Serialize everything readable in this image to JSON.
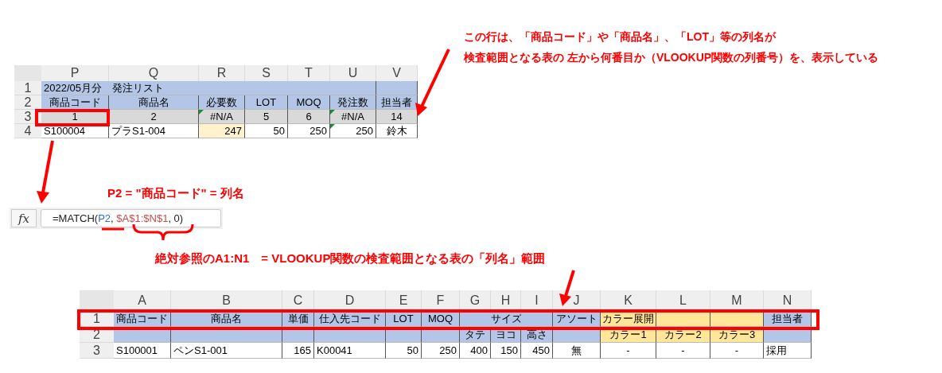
{
  "annotations": [
    {
      "kind": "title",
      "lines": [
        "この行は、「商品コード」や「商品名」、「LOT」等の列名が",
        "検査範囲となる表の 左から何番目か（VLOOKUP関数の列番号）を、表示している"
      ]
    },
    {
      "kind": "formula",
      "lines": [
        "P2 = \"商品コード\" = 列名"
      ]
    },
    {
      "kind": "range",
      "lines": [
        "絶対参照のA1:N1　= VLOOKUP関数の検査範囲となる表の「列名」範囲"
      ]
    }
  ],
  "sheets": [
    {
      "columns": [
        "P",
        "Q",
        "R",
        "S",
        "T",
        "U",
        "V"
      ],
      "rows": [
        {
          "number": "1",
          "cells": [
            {
              "text": "2022/05月分　発注リスト",
              "kind": "title"
            },
            {
              "kind": "merged"
            },
            {
              "kind": "merged"
            },
            {
              "kind": "merged"
            },
            {
              "kind": "merged"
            },
            {
              "kind": "merged"
            },
            {
              "kind": "header"
            }
          ]
        },
        {
          "number": "2",
          "cells": [
            {
              "text": "商品コード",
              "kind": "header"
            },
            {
              "text": "商品名",
              "kind": "header"
            },
            {
              "text": "必要数",
              "kind": "header"
            },
            {
              "text": "LOT",
              "kind": "header"
            },
            {
              "text": "MOQ",
              "kind": "header"
            },
            {
              "text": "発注数",
              "kind": "header"
            },
            {
              "text": "担当者",
              "kind": "header"
            }
          ]
        },
        {
          "number": "3",
          "cells": [
            {
              "text": "1",
              "kind": "index"
            },
            {
              "text": "2",
              "kind": "index"
            },
            {
              "text": "#N/A",
              "kind": "index",
              "flag": true
            },
            {
              "text": "5",
              "kind": "index"
            },
            {
              "text": "6",
              "kind": "index"
            },
            {
              "text": "#N/A",
              "kind": "index",
              "flag": true
            },
            {
              "text": "14",
              "kind": "index"
            }
          ]
        },
        {
          "number": "4",
          "cells": [
            {
              "text": "S100004",
              "kind": "text"
            },
            {
              "text": "プラS1-004",
              "kind": "text"
            },
            {
              "text": "247",
              "kind": "input"
            },
            {
              "text": "50",
              "kind": "number"
            },
            {
              "text": "250",
              "kind": "number"
            },
            {
              "text": "250",
              "kind": "number",
              "flag": true
            },
            {
              "text": "鈴木",
              "kind": "center"
            }
          ]
        }
      ]
    },
    {
      "columns": [
        "A",
        "B",
        "C",
        "D",
        "E",
        "F",
        "G",
        "H",
        "I",
        "J",
        "K",
        "L",
        "M",
        "N"
      ],
      "rows": [
        {
          "number": "1",
          "cells": [
            {
              "text": "商品コード",
              "kind": "header"
            },
            {
              "text": "商品名",
              "kind": "header"
            },
            {
              "text": "単価",
              "kind": "header"
            },
            {
              "text": "仕入先コード",
              "kind": "header"
            },
            {
              "text": "LOT",
              "kind": "header"
            },
            {
              "text": "MOQ",
              "kind": "header"
            },
            {
              "kind": "header-open"
            },
            {
              "text": "サイズ",
              "kind": "header-open"
            },
            {
              "kind": "header"
            },
            {
              "text": "アソート",
              "kind": "header"
            },
            {
              "text": "カラー展開",
              "kind": "accent"
            },
            {
              "kind": "accent"
            },
            {
              "kind": "accent"
            },
            {
              "text": "担当者",
              "kind": "header"
            }
          ]
        },
        {
          "number": "2",
          "cells": [
            {
              "kind": "header"
            },
            {
              "kind": "header"
            },
            {
              "kind": "header"
            },
            {
              "kind": "header"
            },
            {
              "kind": "header"
            },
            {
              "kind": "header"
            },
            {
              "text": "タテ",
              "kind": "header"
            },
            {
              "text": "ヨコ",
              "kind": "header"
            },
            {
              "text": "高さ",
              "kind": "header"
            },
            {
              "kind": "header"
            },
            {
              "text": "カラー1",
              "kind": "accent"
            },
            {
              "text": "カラー2",
              "kind": "accent"
            },
            {
              "text": "カラー3",
              "kind": "accent"
            },
            {
              "kind": "header"
            }
          ]
        },
        {
          "number": "3",
          "cells": [
            {
              "text": "S100001",
              "kind": "text"
            },
            {
              "text": "ペンS1-001",
              "kind": "text"
            },
            {
              "text": "165",
              "kind": "number"
            },
            {
              "text": "K00041",
              "kind": "text"
            },
            {
              "text": "50",
              "kind": "number"
            },
            {
              "text": "250",
              "kind": "number"
            },
            {
              "text": "400",
              "kind": "number"
            },
            {
              "text": "150",
              "kind": "number"
            },
            {
              "text": "450",
              "kind": "number"
            },
            {
              "text": "無",
              "kind": "center"
            },
            {
              "text": "-",
              "kind": "center"
            },
            {
              "text": "-",
              "kind": "center"
            },
            {
              "text": "-",
              "kind": "center"
            },
            {
              "text": "採用",
              "kind": "text"
            }
          ]
        }
      ]
    }
  ],
  "formula_bar": {
    "label": "fx",
    "tokens": [
      {
        "text": "=MATCH(",
        "kind": "plain"
      },
      {
        "text": "P2",
        "kind": "ref1"
      },
      {
        "text": ", ",
        "kind": "plain"
      },
      {
        "text": "$A$1:$N$1",
        "kind": "ref2"
      },
      {
        "text": ", 0)",
        "kind": "plain"
      }
    ]
  }
}
